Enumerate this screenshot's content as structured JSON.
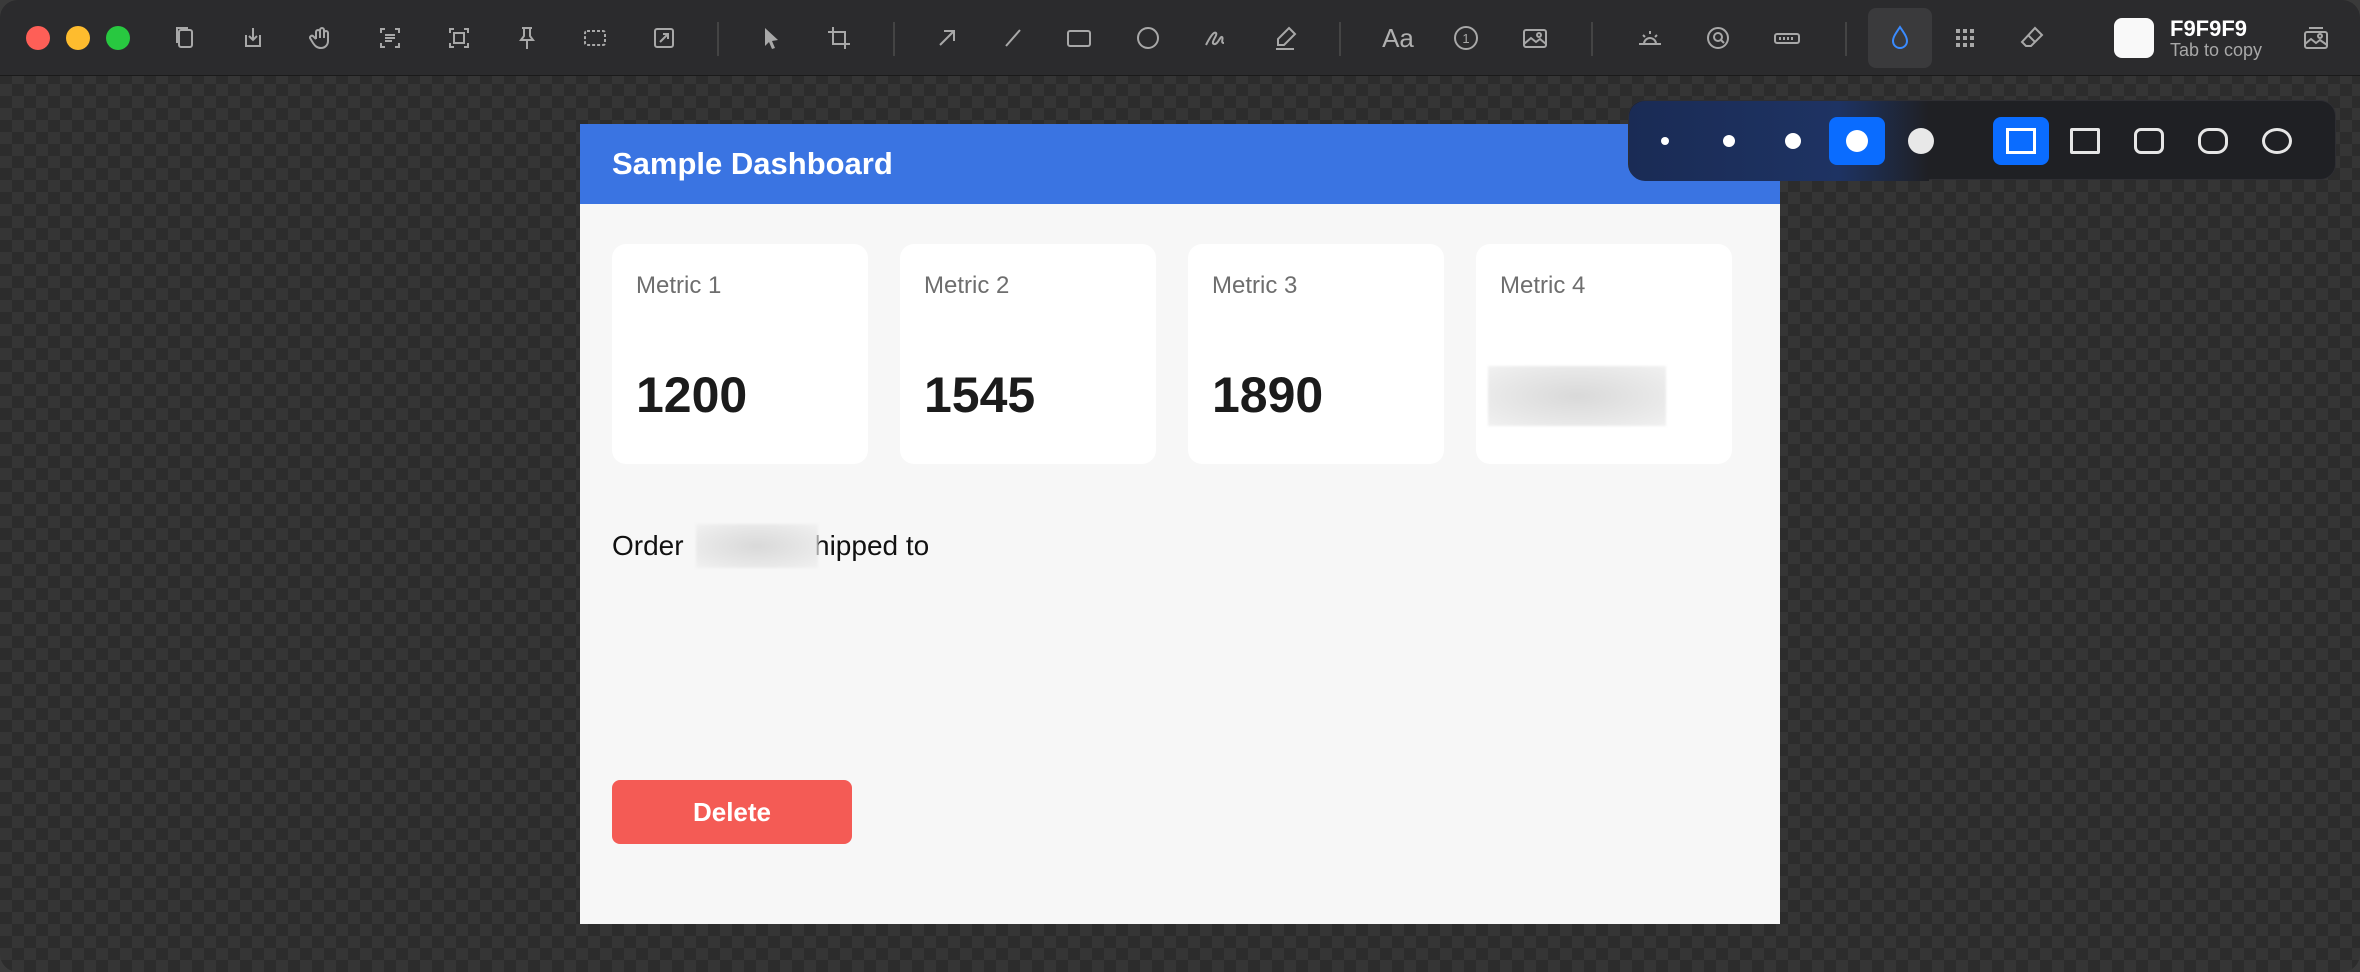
{
  "window": {
    "toolbar_icons": [
      "copy-icon",
      "save-icon",
      "drag-hand-icon",
      "ocr-text-icon",
      "scan-icon",
      "pin-icon",
      "select-area-icon",
      "resize-icon",
      "pointer-icon",
      "crop-icon",
      "arrow-icon",
      "line-icon",
      "rectangle-icon",
      "ellipse-icon",
      "pen-icon",
      "highlighter-icon",
      "text-icon",
      "counter-icon",
      "image-icon",
      "spotlight-icon",
      "magnifier-icon",
      "blur-bar-icon",
      "blur-drop-icon",
      "pixelate-icon",
      "eraser-icon",
      "gallery-icon"
    ],
    "text_tool_label": "Aa",
    "counter_label": "1",
    "color": {
      "hex": "F9F9F9",
      "hint": "Tab to copy",
      "swatch": "#F9F9F9"
    }
  },
  "document": {
    "title": "Sample Dashboard",
    "header_color": "#3a74e2",
    "metrics": [
      {
        "label": "Metric 1",
        "value": "1200"
      },
      {
        "label": "Metric 2",
        "value": "1545"
      },
      {
        "label": "Metric 3",
        "value": "1890"
      },
      {
        "label": "Metric 4",
        "value": ""
      }
    ],
    "order_line": {
      "prefix": "Order",
      "suffix": "hipped to"
    },
    "delete_label": "Delete",
    "delete_color": "#f45b55"
  },
  "palette": {
    "stroke_sizes": [
      "xs",
      "s",
      "m",
      "l",
      "xl"
    ],
    "selected_size": "l",
    "corner_styles": [
      "square",
      "slight",
      "rounded",
      "more-rounded",
      "ellipse"
    ],
    "selected_corner": "square",
    "accent": "#0a6cff"
  }
}
